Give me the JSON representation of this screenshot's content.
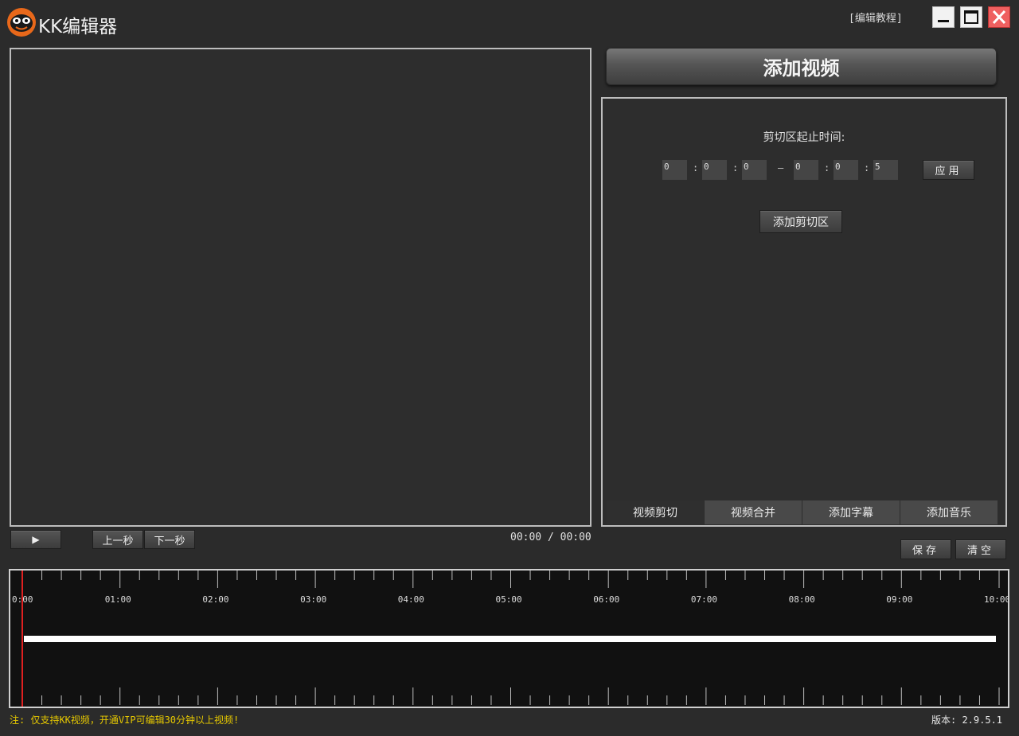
{
  "window": {
    "title": "KK编辑器",
    "tutorial_link": "[编辑教程]",
    "accent_close": "#ef6060"
  },
  "toolbar": {
    "add_video_label": "添加视频"
  },
  "cut_panel": {
    "range_label": "剪切区起止时间:",
    "start": {
      "h": "0",
      "m": "0",
      "s": "0"
    },
    "end": {
      "h": "0",
      "m": "0",
      "s": "5"
    },
    "separator": ":",
    "dash": "–",
    "apply_label": "应用",
    "add_cut_label": "添加剪切区"
  },
  "tabs": [
    {
      "label": "视频剪切",
      "active": true
    },
    {
      "label": "视频合并",
      "active": false
    },
    {
      "label": "添加字幕",
      "active": false
    },
    {
      "label": "添加音乐",
      "active": false
    }
  ],
  "playback": {
    "play_icon": "▶",
    "prev_second_label": "上一秒",
    "next_second_label": "下一秒",
    "time_display": "00:00 / 00:00"
  },
  "actions": {
    "save_label": "保存",
    "clear_label": "清空"
  },
  "timeline": {
    "tick_labels": [
      "0:00",
      "01:00",
      "02:00",
      "03:00",
      "04:00",
      "05:00",
      "06:00",
      "07:00",
      "08:00",
      "09:00",
      "10:00"
    ],
    "playhead_color": "#e02020",
    "clip_color": "#ffffff"
  },
  "footer": {
    "note": "注: 仅支持KK视频，开通VIP可编辑30分钟以上视频!",
    "version": "版本: 2.9.5.1",
    "note_color": "#e6c800"
  }
}
